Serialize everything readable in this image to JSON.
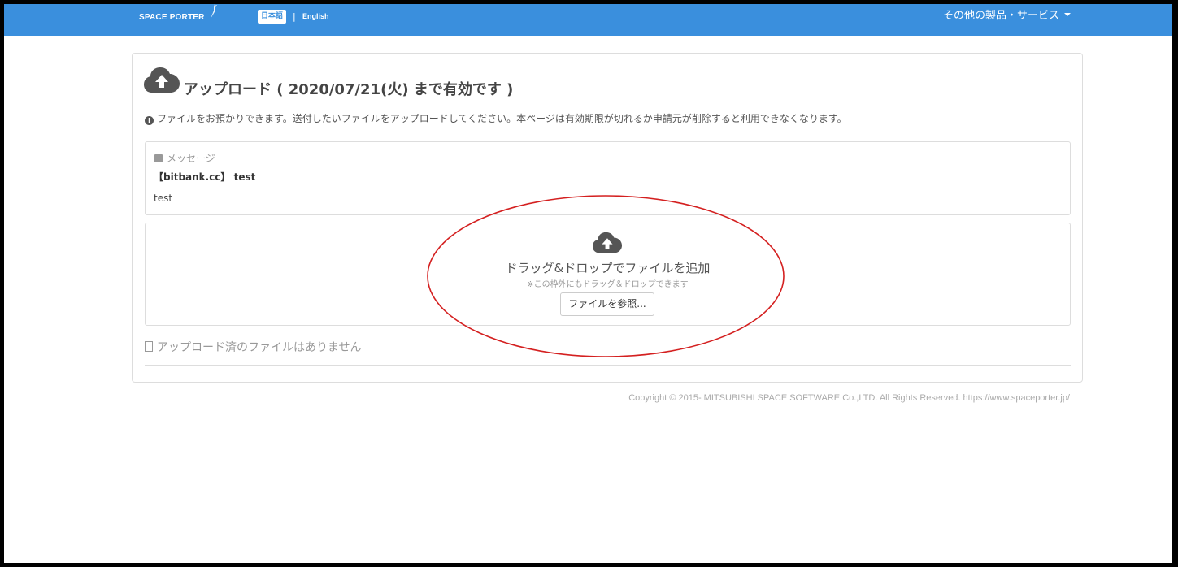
{
  "header": {
    "brand": "SPACE PORTER",
    "lang_ja": "日本語",
    "lang_sep": "|",
    "lang_en": "English",
    "menu": "その他の製品・サービス",
    "bg_color": "#3a8fdd"
  },
  "upload": {
    "title": "アップロード ( 2020/07/21(火) まで有効です )",
    "notice": "ファイルをお預かりできます。送付したいファイルをアップロードしてください。本ページは有効期限が切れるか申請元が削除すると利用できなくなります。",
    "message": {
      "label": "メッセージ",
      "subject": "【bitbank.cc】 test",
      "body": "test"
    },
    "dropzone": {
      "title": "ドラッグ&ドロップでファイルを追加",
      "subtitle": "※この枠外にもドラッグ＆ドロップできます",
      "browse_label": "ファイルを参照..."
    },
    "files_empty": "アップロード済のファイルはありません"
  },
  "footer": {
    "copyright": "Copyright © 2015- MITSUBISHI SPACE SOFTWARE Co.,LTD. All Rights Reserved. https://www.spaceporter.jp/"
  },
  "icons": [
    "cloud-upload-icon",
    "info-icon",
    "note-icon",
    "file-icon",
    "caret-down-icon"
  ],
  "annotation_color": "#d42020"
}
